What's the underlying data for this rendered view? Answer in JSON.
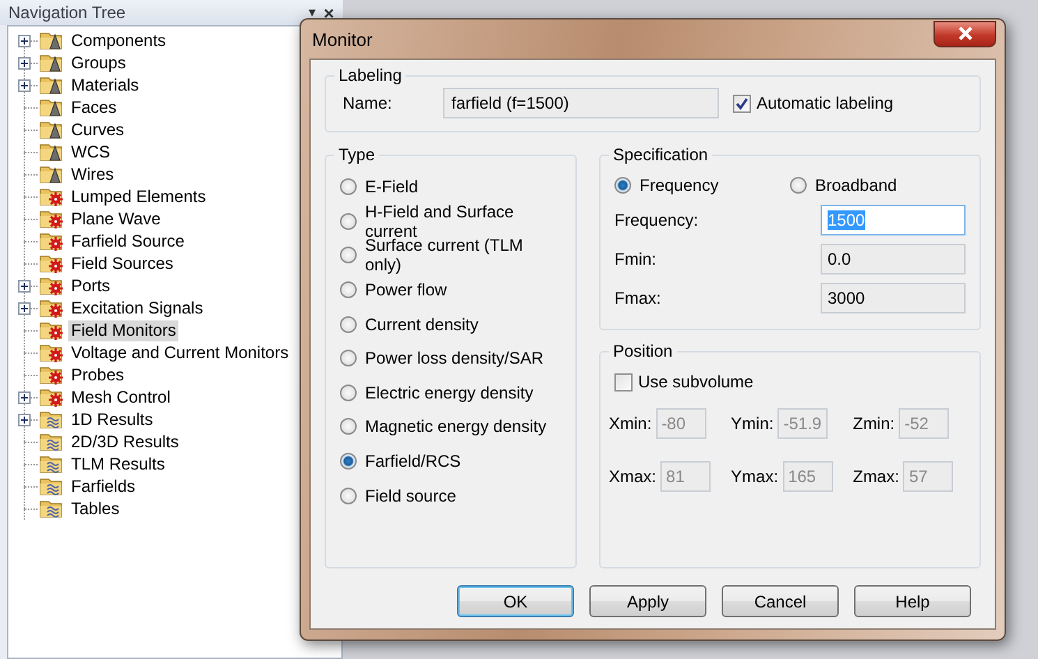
{
  "navigation_tree": {
    "title": "Navigation Tree",
    "menu_glyph": "▾",
    "close_glyph": "×",
    "items": [
      {
        "label": "Components",
        "kind": "geometry",
        "expandable": true,
        "selected": false
      },
      {
        "label": "Groups",
        "kind": "geometry",
        "expandable": true,
        "selected": false
      },
      {
        "label": "Materials",
        "kind": "geometry",
        "expandable": true,
        "selected": false
      },
      {
        "label": "Faces",
        "kind": "geometry",
        "expandable": false,
        "selected": false
      },
      {
        "label": "Curves",
        "kind": "geometry",
        "expandable": false,
        "selected": false
      },
      {
        "label": "WCS",
        "kind": "geometry",
        "expandable": false,
        "selected": false
      },
      {
        "label": "Wires",
        "kind": "geometry",
        "expandable": false,
        "selected": false
      },
      {
        "label": "Lumped Elements",
        "kind": "source",
        "expandable": false,
        "selected": false
      },
      {
        "label": "Plane Wave",
        "kind": "source",
        "expandable": false,
        "selected": false
      },
      {
        "label": "Farfield Source",
        "kind": "source",
        "expandable": false,
        "selected": false
      },
      {
        "label": "Field Sources",
        "kind": "source",
        "expandable": false,
        "selected": false
      },
      {
        "label": "Ports",
        "kind": "source",
        "expandable": true,
        "selected": false
      },
      {
        "label": "Excitation Signals",
        "kind": "source",
        "expandable": true,
        "selected": false
      },
      {
        "label": "Field Monitors",
        "kind": "source",
        "expandable": false,
        "selected": true
      },
      {
        "label": "Voltage and Current Monitors",
        "kind": "source",
        "expandable": false,
        "selected": false
      },
      {
        "label": "Probes",
        "kind": "source",
        "expandable": false,
        "selected": false
      },
      {
        "label": "Mesh Control",
        "kind": "source",
        "expandable": true,
        "selected": false
      },
      {
        "label": "1D Results",
        "kind": "result",
        "expandable": true,
        "selected": false
      },
      {
        "label": "2D/3D Results",
        "kind": "result",
        "expandable": false,
        "selected": false
      },
      {
        "label": "TLM Results",
        "kind": "result",
        "expandable": false,
        "selected": false
      },
      {
        "label": "Farfields",
        "kind": "result",
        "expandable": false,
        "selected": false
      },
      {
        "label": "Tables",
        "kind": "result",
        "expandable": false,
        "selected": false
      }
    ]
  },
  "dialog": {
    "title": "Monitor",
    "labeling": {
      "legend": "Labeling",
      "name_label": "Name:",
      "name_value": "farfield (f=1500)",
      "auto_label": "Automatic labeling",
      "auto_checked": true
    },
    "type": {
      "legend": "Type",
      "options": [
        {
          "label": "E-Field",
          "selected": false
        },
        {
          "label": "H-Field and Surface current",
          "selected": false
        },
        {
          "label": "Surface current (TLM only)",
          "selected": false
        },
        {
          "label": "Power flow",
          "selected": false
        },
        {
          "label": "Current density",
          "selected": false
        },
        {
          "label": "Power loss density/SAR",
          "selected": false
        },
        {
          "label": "Electric energy density",
          "selected": false
        },
        {
          "label": "Magnetic energy density",
          "selected": false
        },
        {
          "label": "Farfield/RCS",
          "selected": true
        },
        {
          "label": "Field source",
          "selected": false
        }
      ]
    },
    "specification": {
      "legend": "Specification",
      "modes": [
        {
          "label": "Frequency",
          "selected": true
        },
        {
          "label": "Broadband",
          "selected": false
        }
      ],
      "fields": [
        {
          "label": "Frequency:",
          "value": "1500",
          "editable": true,
          "highlighted": true
        },
        {
          "label": "Fmin:",
          "value": "0.0",
          "editable": false,
          "highlighted": false
        },
        {
          "label": "Fmax:",
          "value": "3000",
          "editable": false,
          "highlighted": false
        }
      ]
    },
    "position": {
      "legend": "Position",
      "subvolume_label": "Use subvolume",
      "subvolume_checked": false,
      "fields": [
        {
          "label": "Xmin:",
          "value": "-80",
          "disabled": true
        },
        {
          "label": "Ymin:",
          "value": "-51.9",
          "disabled": true
        },
        {
          "label": "Zmin:",
          "value": "-52",
          "disabled": true
        },
        {
          "label": "Xmax:",
          "value": "81",
          "disabled": true
        },
        {
          "label": "Ymax:",
          "value": "165",
          "disabled": true
        },
        {
          "label": "Zmax:",
          "value": "57",
          "disabled": true
        }
      ]
    },
    "buttons": [
      {
        "label": "OK",
        "default": true
      },
      {
        "label": "Apply",
        "default": false
      },
      {
        "label": "Cancel",
        "default": false
      },
      {
        "label": "Help",
        "default": false
      }
    ]
  }
}
